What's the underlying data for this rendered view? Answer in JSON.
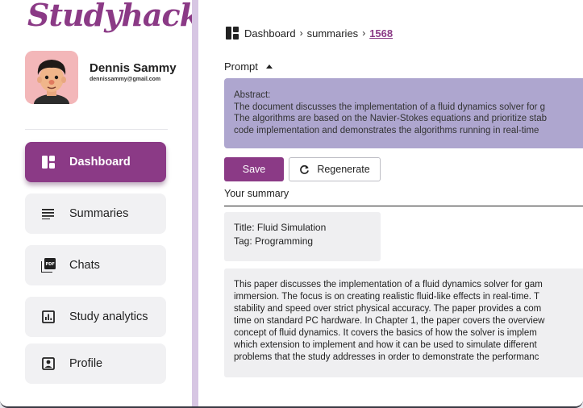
{
  "app": {
    "logo": "Studyhacks"
  },
  "user": {
    "name": "Dennis Sammy",
    "email": "dennissammy@gmail.com"
  },
  "sidebar": {
    "items": [
      {
        "label": "Dashboard",
        "icon": "dashboard-icon",
        "active": true
      },
      {
        "label": "Summaries",
        "icon": "list-icon",
        "active": false
      },
      {
        "label": "Chats",
        "icon": "pdf-icon",
        "active": false
      },
      {
        "label": "Study analytics",
        "icon": "analytics-icon",
        "active": false
      },
      {
        "label": "Profile",
        "icon": "profile-icon",
        "active": false
      }
    ]
  },
  "breadcrumb": {
    "items": [
      "Dashboard",
      "summaries",
      "1568"
    ]
  },
  "prompt": {
    "label": "Prompt",
    "lines": [
      "Abstract:",
      "The document discusses the implementation of a fluid dynamics solver for g",
      "The algorithms are based on the Navier-Stokes equations and prioritize stab",
      "code implementation and demonstrates the algorithms running in real-time"
    ]
  },
  "actions": {
    "save_label": "Save",
    "regenerate_label": "Regenerate"
  },
  "summary": {
    "heading": "Your summary",
    "title_line": "Title: Fluid Simulation",
    "tag_line": "Tag:  Programming",
    "body_lines": [
      "This paper discusses the implementation of a fluid dynamics solver for gam",
      "immersion. The focus is on creating realistic fluid-like effects in real-time. T",
      "stability and speed over strict physical accuracy. The paper provides a com",
      "time on standard PC hardware. In Chapter 1, the paper covers the overview",
      "concept of fluid dynamics. It covers the basics of how the solver is implem",
      "which extension to implement and how it can be used to simulate different",
      "problems that the study addresses in order to demonstrate the performanc"
    ]
  },
  "colors": {
    "accent": "#8b3a86",
    "prompt_bg": "#aea6cf",
    "sidebar_sep": "#d7c6e3"
  }
}
